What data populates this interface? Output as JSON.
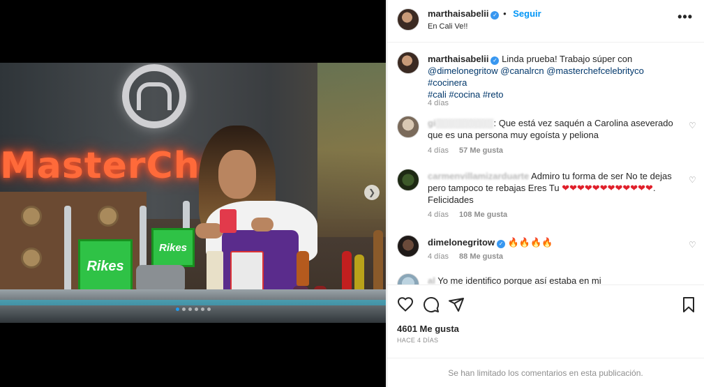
{
  "post": {
    "username": "marthaisabelii",
    "follow_label": "Seguir",
    "location": "En Cali Ve!!",
    "more_icon": "more-horizontal-icon"
  },
  "caption": {
    "username": "marthaisabelii",
    "text": "Linda prueba! Trabajo súper con",
    "tags": [
      "@dimelonegritow",
      "@canalrcn",
      "@masterchefcelebrityco",
      "#cocinera",
      "#cali",
      "#cocina",
      "#reto"
    ],
    "time": "4 días"
  },
  "comments": [
    {
      "username": "gi",
      "text": "Que está vez saquén a Carolina aseverado que es una persona muy egoísta y peliona",
      "time": "4 días",
      "likes": "57 Me gusta"
    },
    {
      "username": "carmenvillamizarduarte",
      "text": "Admiro tu forma de ser No te dejas pero tampoco te rebajas Eres Tu",
      "hearts": "❤❤❤❤❤❤❤❤❤❤❤❤",
      "suffix": ". Felicidades",
      "time": "4 días",
      "likes": "108 Me gusta"
    },
    {
      "username": "dimelonegritow",
      "text": "🔥🔥🔥🔥",
      "time": "4 días",
      "likes": "88 Me gusta"
    },
    {
      "username": "al",
      "text": "Yo me identifico porque así estaba en mi"
    }
  ],
  "engagement": {
    "likes": "4601 Me gusta",
    "date": "HACE 4 DÍAS",
    "limited": "Se han limitado los comentarios en esta publicación."
  },
  "media": {
    "neon_sign": "MasterChef",
    "sign_brand": "Rikes",
    "carousel_dots": 6,
    "active_dot": 0
  },
  "colors": {
    "accent": "#0095f6",
    "verified": "#3897f0",
    "muted": "#8e8e8e"
  }
}
